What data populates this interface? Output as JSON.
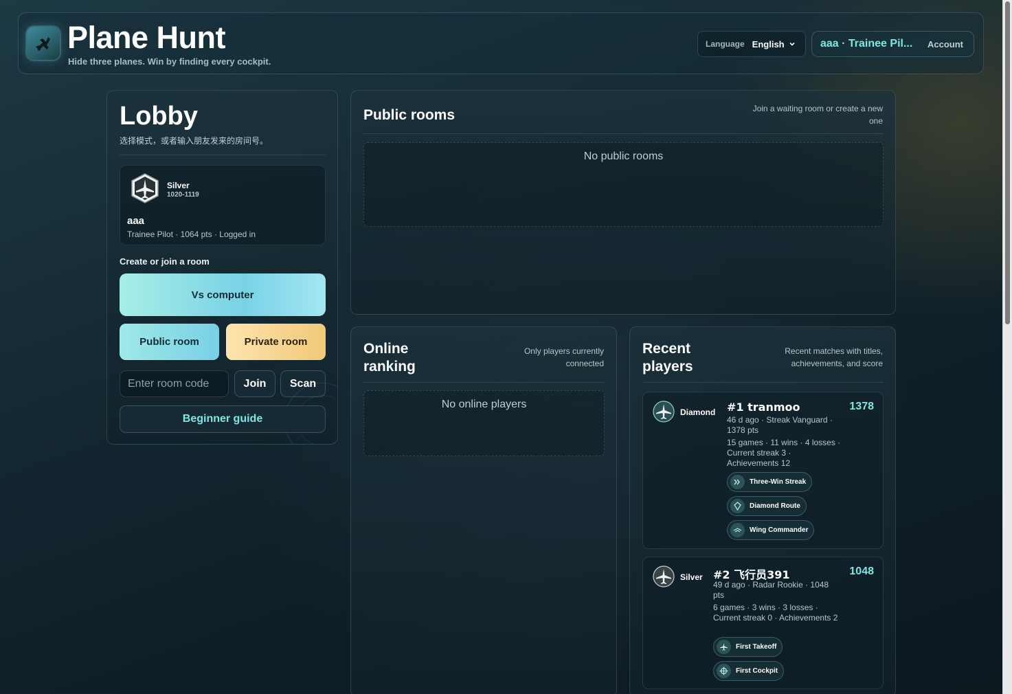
{
  "header": {
    "title": "Plane Hunt",
    "subtitle": "Hide three planes. Win by finding every cockpit.",
    "language_label": "Language",
    "language_value": "English",
    "account_name": "aaa · Trainee Pil...",
    "account_button": "Account"
  },
  "lobby": {
    "title": "Lobby",
    "subtitle": "选择模式，或者输入朋友发来的房间号。",
    "profile": {
      "rank": "Silver",
      "rank_range": "1020-1119",
      "name": "aaa",
      "meta": "Trainee Pilot · 1064 pts · Logged in"
    },
    "section_label": "Create or join a room",
    "vs_computer": "Vs computer",
    "public_room": "Public room",
    "private_room": "Private room",
    "room_code_placeholder": "Enter room code",
    "join": "Join",
    "scan": "Scan",
    "guide": "Beginner guide"
  },
  "public_rooms": {
    "title": "Public rooms",
    "note": "Join a waiting room or create a new one",
    "empty": "No public rooms"
  },
  "online_ranking": {
    "title": "Online ranking",
    "note": "Only players currently connected",
    "empty": "No online players"
  },
  "recent_players": {
    "title": "Recent players",
    "note": "Recent matches with titles, achievements, and score",
    "players": [
      {
        "tier": "Diamond",
        "name": "#1 tranmoo",
        "score": "1378",
        "line1": "46 d ago · Streak Vanguard · 1378 pts",
        "line2": "15 games · 11 wins · 4 losses · Current streak 3 · Achievements 12",
        "chips": [
          "Three-Win Streak",
          "Diamond Route",
          "Wing Commander"
        ]
      },
      {
        "tier": "Silver",
        "name": "#2 飞行员391",
        "score": "1048",
        "line1": "49 d ago · Radar Rookie · 1048 pts",
        "line2": "6 games · 3 wins · 3 losses · Current streak 0 · Achievements 2",
        "chips": [
          "First Takeoff",
          "First Cockpit"
        ]
      }
    ]
  },
  "colors": {
    "accent": "#7fe7e2",
    "vs_button": "#79d2e6",
    "private_button": "#f1c878",
    "background": "#152a34"
  }
}
